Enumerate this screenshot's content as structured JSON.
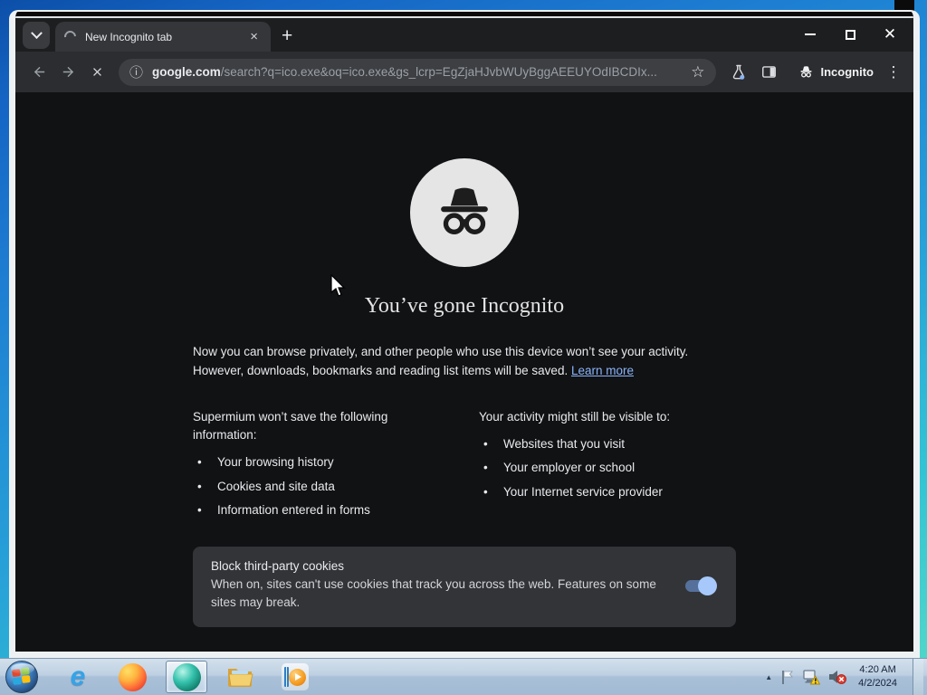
{
  "colors": {
    "accent_link": "#8ab4f8",
    "toggle_track": "#55709b",
    "toggle_knob": "#a6c8fa",
    "frame_dark": "#1d1e20",
    "toolbar": "#2c2d30",
    "page_bg": "#111214",
    "taskbar": "#aac1d8"
  },
  "window": {
    "tab": {
      "title": "New Incognito tab",
      "close_glyph": "×",
      "new_tab_glyph": "+"
    },
    "controls": {
      "minimize": "minimize",
      "maximize": "maximize",
      "close_glyph": "✕"
    },
    "toolbar": {
      "info_glyph": "ⓘ",
      "url_host": "google.com",
      "url_path": "/search?q=ico.exe&oq=ico.exe&gs_lcrp=EgZjaHJvbWUyBggAEEUYOdIBCDIx...",
      "star_glyph": "☆",
      "incognito_label": "Incognito",
      "menu_glyph": "⋮"
    }
  },
  "page": {
    "title": "You’ve gone Incognito",
    "body_line1": "Now you can browse privately, and other people who use this device won’t see your activity.",
    "body_line2": "However, downloads, bookmarks and reading list items will be saved. ",
    "learn_more": "Learn more",
    "wont_save": {
      "heading": "Supermium won’t save the following information:",
      "items": [
        "Your browsing history",
        "Cookies and site data",
        "Information entered in forms"
      ]
    },
    "visible_to": {
      "heading": "Your activity might still be visible to:",
      "items": [
        "Websites that you visit",
        "Your employer or school",
        "Your Internet service provider"
      ]
    },
    "cookies": {
      "title": "Block third-party cookies",
      "description": "When on, sites can't use cookies that track you across the web. Features on some sites may break.",
      "toggle_state": "on"
    }
  },
  "taskbar": {
    "clock_time": "4:20 AM",
    "clock_date": "4/2/2024",
    "apps": [
      {
        "name": "Internet Explorer"
      },
      {
        "name": "Firefox"
      },
      {
        "name": "Supermium",
        "active": true
      },
      {
        "name": "Windows Explorer"
      },
      {
        "name": "Windows Media Player"
      }
    ],
    "tray_up_glyph": "▲"
  },
  "icons": {
    "tab_search": "chevron-down",
    "loading": "spinner-arc",
    "back": "arrow-left",
    "forward": "arrow-right",
    "stop": "x-cross",
    "experiments": "flask-with-blue-dot",
    "side_panel": "split-square",
    "incognito": "hat-and-glasses",
    "tray": [
      "hidden-icons-arrow",
      "action-center-flag",
      "network-warning",
      "volume-muted"
    ]
  }
}
